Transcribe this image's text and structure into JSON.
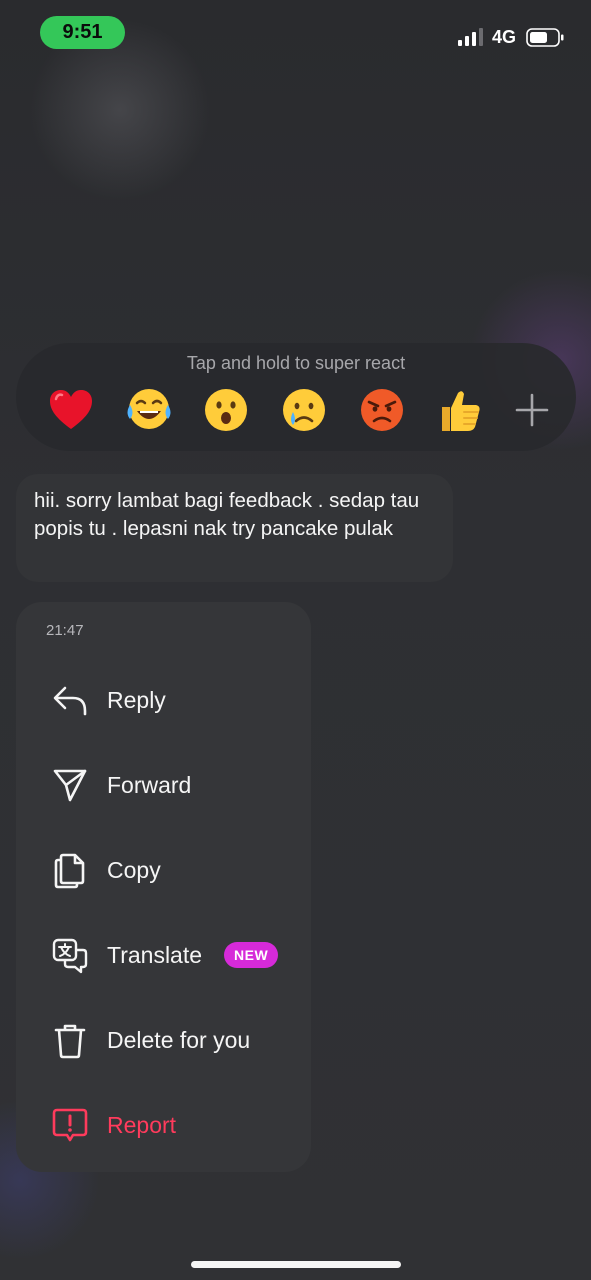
{
  "status_bar": {
    "time": "9:51",
    "network": "4G",
    "colors": {
      "time_pill": "#34c759"
    }
  },
  "reactions": {
    "hint": "Tap and hold to super react",
    "emojis": [
      {
        "name": "red-heart",
        "char": "❤️"
      },
      {
        "name": "face-with-tears-of-joy",
        "char": "😂"
      },
      {
        "name": "face-with-open-mouth",
        "char": "😮"
      },
      {
        "name": "crying-face",
        "char": "😢"
      },
      {
        "name": "angry-face",
        "char": "😡"
      },
      {
        "name": "thumbs-up",
        "char": "👍"
      }
    ],
    "more_icon": "plus-icon"
  },
  "message": {
    "text": "hii. sorry lambat bagi feedback . sedap tau popis tu . lepasni nak try pancake pulak"
  },
  "menu": {
    "timestamp": "21:47",
    "items": [
      {
        "label": "Reply",
        "icon": "reply-arrow-icon"
      },
      {
        "label": "Forward",
        "icon": "paper-plane-icon"
      },
      {
        "label": "Copy",
        "icon": "copy-icon"
      },
      {
        "label": "Translate",
        "icon": "translate-icon",
        "badge": "NEW"
      },
      {
        "label": "Delete for you",
        "icon": "trash-icon"
      },
      {
        "label": "Report",
        "icon": "report-icon",
        "danger": true
      }
    ],
    "colors": {
      "badge": "#d62ad9",
      "danger": "#ff3b5c"
    }
  }
}
